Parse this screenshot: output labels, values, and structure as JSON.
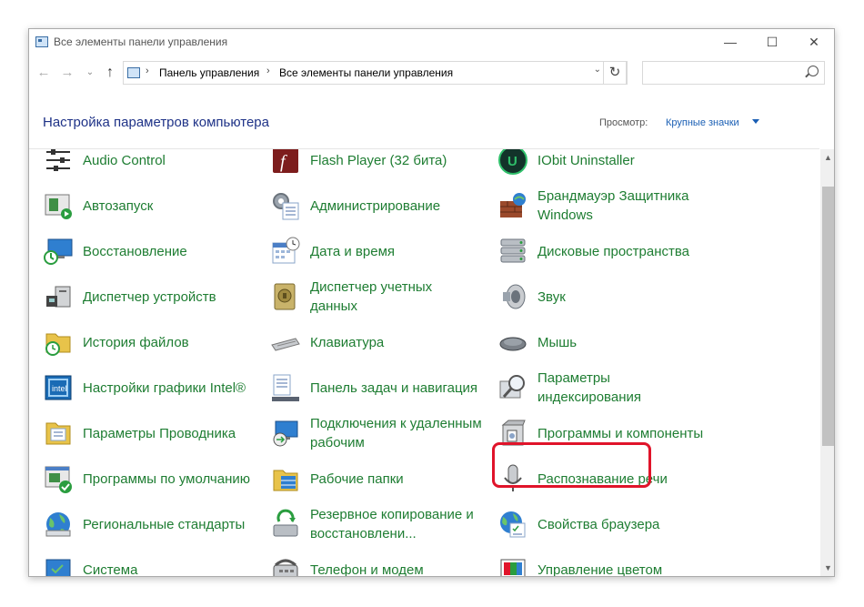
{
  "window": {
    "title": "Все элементы панели управления",
    "minimize": "—",
    "maximize": "☐",
    "close": "✕"
  },
  "nav": {
    "back": "←",
    "forward": "→",
    "history": "⌄",
    "up": "↑",
    "breadcrumb": [
      "Панель управления",
      "Все элементы панели управления"
    ],
    "separator": "›",
    "refresh": "↻",
    "search_placeholder": ""
  },
  "header": {
    "heading": "Настройка параметров компьютера",
    "view_label": "Просмотр:",
    "view_value": "Крупные значки"
  },
  "items": [
    {
      "label": "Audio Control",
      "icon": "audio-control-icon"
    },
    {
      "label": "Flash Player (32 бита)",
      "icon": "flash-player-icon"
    },
    {
      "label": "IObit Uninstaller",
      "icon": "iobit-uninstaller-icon"
    },
    {
      "label": "Автозапуск",
      "icon": "autoplay-icon"
    },
    {
      "label": "Администрирование",
      "icon": "administrative-tools-icon"
    },
    {
      "label": "Брандмауэр Защитника Windows",
      "icon": "firewall-icon"
    },
    {
      "label": "Восстановление",
      "icon": "recovery-icon"
    },
    {
      "label": "Дата и время",
      "icon": "date-time-icon"
    },
    {
      "label": "Дисковые пространства",
      "icon": "storage-spaces-icon"
    },
    {
      "label": "Диспетчер устройств",
      "icon": "device-manager-icon"
    },
    {
      "label": "Диспетчер учетных данных",
      "icon": "credential-manager-icon"
    },
    {
      "label": "Звук",
      "icon": "sound-icon"
    },
    {
      "label": "История файлов",
      "icon": "file-history-icon"
    },
    {
      "label": "Клавиатура",
      "icon": "keyboard-icon"
    },
    {
      "label": "Мышь",
      "icon": "mouse-icon"
    },
    {
      "label": "Настройки графики Intel®",
      "icon": "intel-graphics-icon"
    },
    {
      "label": "Панель задач и навигация",
      "icon": "taskbar-icon"
    },
    {
      "label": "Параметры индексирования",
      "icon": "indexing-options-icon"
    },
    {
      "label": "Параметры Проводника",
      "icon": "explorer-options-icon"
    },
    {
      "label": "Подключения к удаленным рабочим",
      "icon": "remote-desktop-icon"
    },
    {
      "label": "Программы и компоненты",
      "icon": "programs-features-icon"
    },
    {
      "label": "Программы по умолчанию",
      "icon": "default-programs-icon"
    },
    {
      "label": "Рабочие папки",
      "icon": "work-folders-icon"
    },
    {
      "label": "Распознавание речи",
      "icon": "speech-recognition-icon"
    },
    {
      "label": "Региональные стандарты",
      "icon": "region-icon"
    },
    {
      "label": "Резервное копирование и восстановлени...",
      "icon": "backup-restore-icon"
    },
    {
      "label": "Свойства браузера",
      "icon": "internet-options-icon"
    },
    {
      "label": "Система",
      "icon": "system-icon"
    },
    {
      "label": "Телефон и модем",
      "icon": "phone-modem-icon"
    },
    {
      "label": "Управление цветом",
      "icon": "color-management-icon"
    }
  ],
  "highlighted_item": "Программы и компоненты",
  "colors": {
    "item_text": "#1e7d32",
    "heading": "#1e3287",
    "highlight_border": "#e0142a",
    "link": "#1a5fb4"
  }
}
